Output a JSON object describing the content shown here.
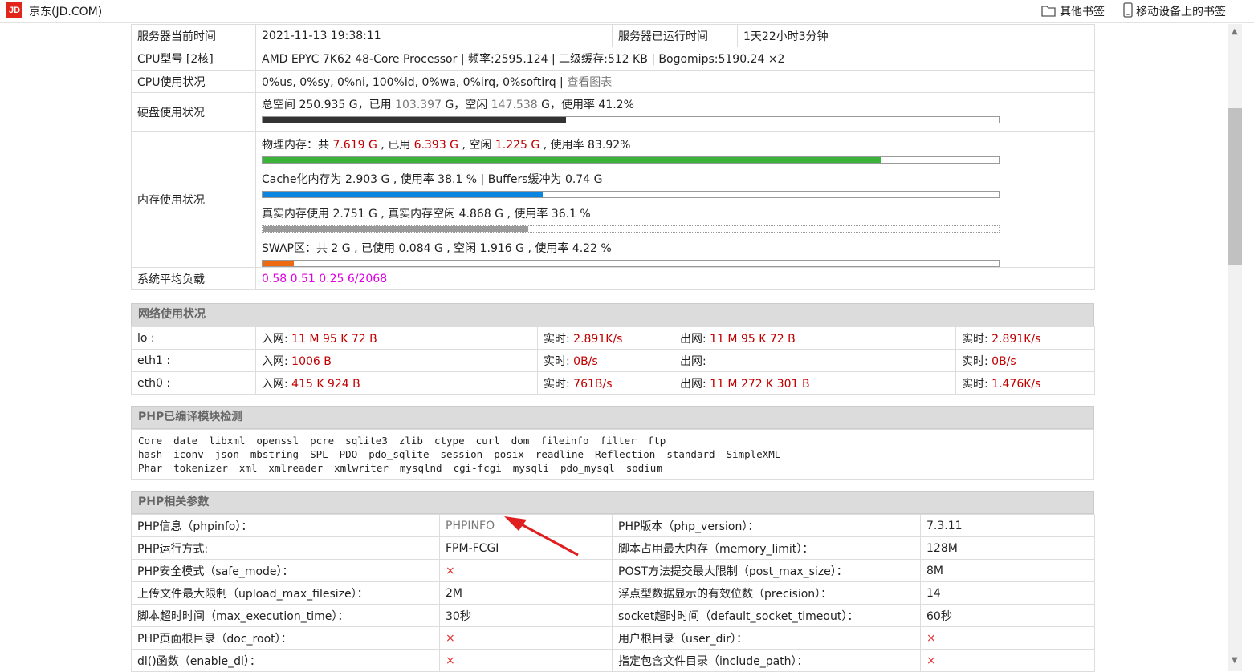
{
  "browser": {
    "site_name": "京东(JD.COM)",
    "bookmark_other": "其他书签",
    "bookmark_mobile": "移动设备上的书签"
  },
  "server": {
    "current_time_label": "服务器当前时间",
    "current_time": "2021-11-13 19:38:11",
    "uptime_label": "服务器已运行时间",
    "uptime": "1天22小时3分钟",
    "cpu_label": "CPU型号 [2核]",
    "cpu": "AMD EPYC 7K62 48-Core Processor | 频率:2595.124 | 二级缓存:512 KB | Bogomips:5190.24 ×2",
    "cpu_usage_label": "CPU使用状况",
    "cpu_usage": "0%us, 0%sy, 0%ni, 100%id, 0%wa, 0%irq, 0%softirq | ",
    "cpu_chart_link": "查看图表",
    "disk_label": "硬盘使用状况",
    "disk_total": "总空间 250.935 G，已用 ",
    "disk_used": "103.397",
    "disk_mid": " G，空闲 ",
    "disk_free": "147.538",
    "disk_tail": " G，使用率 41.2%",
    "disk_usage_pct": 41.2,
    "mem_label": "内存使用状况",
    "mem_phys_1": "物理内存：共 ",
    "mem_phys_total": "7.619 G",
    "mem_phys_2": " , 已用 ",
    "mem_phys_used": "6.393 G",
    "mem_phys_3": " , 空闲 ",
    "mem_phys_free": "1.225 G",
    "mem_phys_4": " , 使用率 83.92%",
    "mem_phys_pct": 83.92,
    "mem_cache": "Cache化内存为 2.903 G , 使用率 38.1 % | Buffers缓冲为 0.74 G",
    "mem_cache_pct": 38.1,
    "mem_real": "真实内存使用 2.751 G , 真实内存空闲 4.868 G , 使用率 36.1 %",
    "mem_real_pct": 36.1,
    "mem_swap": "SWAP区：共 2 G , 已使用 0.084 G , 空闲 1.916 G , 使用率 4.22 %",
    "mem_swap_pct": 4.22,
    "load_label": "系统平均负载",
    "load": "0.58 0.51 0.25 6/2068"
  },
  "network": {
    "title": "网络使用状况",
    "in_label": "入网: ",
    "out_label": "出网: ",
    "rt_label": "实时: ",
    "rows": [
      {
        "iface": "lo :",
        "in": "11 M 95 K 72 B",
        "in_rt": "2.891K/s",
        "out": "11 M 95 K 72 B",
        "out_rt": "2.891K/s"
      },
      {
        "iface": "eth1 :",
        "in": "1006 B",
        "in_rt": "0B/s",
        "out": "",
        "out_rt": "0B/s"
      },
      {
        "iface": "eth0 :",
        "in": "415 K 924 B",
        "in_rt": "761B/s",
        "out": "11 M 272 K 301 B",
        "out_rt": "1.476K/s"
      }
    ]
  },
  "modules": {
    "title": "PHP已编译模块检测",
    "line1": [
      "Core",
      "date",
      "libxml",
      "openssl",
      "pcre",
      "sqlite3",
      "zlib",
      "ctype",
      "curl",
      "dom",
      "fileinfo",
      "filter",
      "ftp"
    ],
    "line2": [
      "hash",
      "iconv",
      "json",
      "mbstring",
      "SPL",
      "PDO",
      "pdo_sqlite",
      "session",
      "posix",
      "readline",
      "Reflection",
      "standard",
      "SimpleXML"
    ],
    "line3": [
      "Phar",
      "tokenizer",
      "xml",
      "xmlreader",
      "xmlwriter",
      "mysqlnd",
      "cgi-fcgi",
      "mysqli",
      "pdo_mysql",
      "sodium"
    ]
  },
  "php": {
    "title": "PHP相关参数",
    "rows": [
      {
        "l1": "PHP信息（phpinfo）：",
        "v1": "PHPINFO",
        "l2": "PHP版本（php_version）：",
        "v2": "7.3.11"
      },
      {
        "l1": "PHP运行方式:",
        "v1": "FPM-FCGI",
        "l2": "脚本占用最大内存（memory_limit）：",
        "v2": "128M"
      },
      {
        "l1": "PHP安全模式（safe_mode）：",
        "v1": "×",
        "l2": "POST方法提交最大限制（post_max_size）：",
        "v2": "8M"
      },
      {
        "l1": "上传文件最大限制（upload_max_filesize）：",
        "v1": "2M",
        "l2": "浮点型数据显示的有效位数（precision）：",
        "v2": "14"
      },
      {
        "l1": "脚本超时时间（max_execution_time）：",
        "v1": "30秒",
        "l2": "socket超时时间（default_socket_timeout）：",
        "v2": "60秒"
      },
      {
        "l1": "PHP页面根目录（doc_root）：",
        "v1": "×",
        "l2": "用户根目录（user_dir）：",
        "v2": "×"
      },
      {
        "l1": "dl()函数（enable_dl）：",
        "v1": "×",
        "l2": "指定包含文件目录（include_path）：",
        "v2": "×"
      }
    ]
  },
  "colors": {
    "phys_bar": "#3bb33b",
    "cache_bar": "#0a86e0",
    "real_bar": "#9a9a9a",
    "swap_bar": "#ee6a10",
    "disk_bar": "#333333",
    "annotation_arrow": "#e02020"
  }
}
